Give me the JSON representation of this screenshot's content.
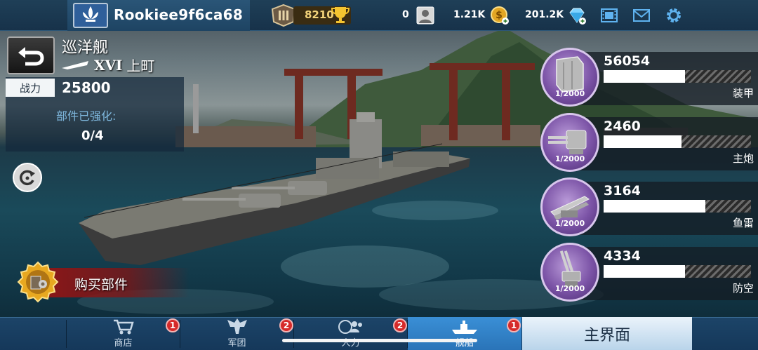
{
  "topbar": {
    "username": "Rookiee9f6ca68",
    "points": "8210",
    "stat1": "0",
    "gold": "1.21K",
    "diamonds": "201.2K"
  },
  "ship": {
    "class_name": "巡洋舰",
    "tier": "XVI",
    "name": "上町",
    "power_label": "战力",
    "power_value": "25800",
    "enhance_label": "部件已强化:",
    "enhance_value": "0/4"
  },
  "buy": {
    "label": "购买部件"
  },
  "parts": [
    {
      "value": "56054",
      "name": "装甲",
      "count": "1/2000",
      "fill": 0.55,
      "icon": "armor-icon"
    },
    {
      "value": "2460",
      "name": "主炮",
      "count": "1/2000",
      "fill": 0.53,
      "icon": "main-gun-icon"
    },
    {
      "value": "3164",
      "name": "鱼雷",
      "count": "1/2000",
      "fill": 0.69,
      "icon": "torpedo-icon"
    },
    {
      "value": "4334",
      "name": "防空",
      "count": "1/2000",
      "fill": 0.55,
      "icon": "anti-air-icon"
    }
  ],
  "nav": {
    "shop": "商店",
    "legion": "军团",
    "force": "人力",
    "ships": "舰船",
    "main": "主界面",
    "badges": [
      "1",
      "2",
      "2",
      "1"
    ]
  },
  "colors": {
    "accent": "#2a74b8",
    "badge": "#d62a2a",
    "part_circle": "#7b53a6"
  }
}
